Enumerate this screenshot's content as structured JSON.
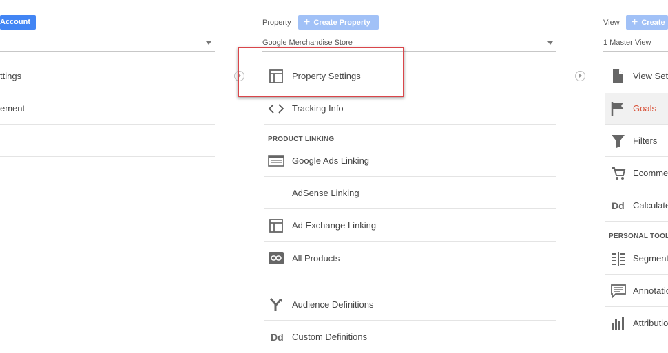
{
  "account": {
    "create_label": "Account",
    "items": [
      {
        "label": "ttings"
      },
      {
        "label": "ement"
      },
      {
        "label": ""
      },
      {
        "label": ""
      }
    ]
  },
  "property": {
    "header_label": "Property",
    "create_label": "Create Property",
    "selector_value": "Google Merchandise Store",
    "items": [
      {
        "label": "Property Settings",
        "icon": "property-settings-icon"
      },
      {
        "label": "Tracking Info",
        "icon": "code-brackets-icon"
      }
    ],
    "section_label": "PRODUCT LINKING",
    "linking_items": [
      {
        "label": "Google Ads Linking",
        "icon": "ads-linking-icon"
      },
      {
        "label": "AdSense Linking",
        "icon": ""
      },
      {
        "label": "Ad Exchange Linking",
        "icon": "ad-exchange-icon"
      },
      {
        "label": "All Products",
        "icon": "link-icon"
      }
    ],
    "more_items": [
      {
        "label": "Audience Definitions",
        "icon": "audience-fork-icon"
      },
      {
        "label": "Custom Definitions",
        "icon": "dd-icon",
        "icon_text": "Dd"
      }
    ]
  },
  "view": {
    "header_label": "View",
    "create_label": "Create",
    "selector_value": "1 Master View",
    "items": [
      {
        "label": "View Set",
        "icon": "document-icon"
      },
      {
        "label": "Goals",
        "icon": "flag-icon",
        "selected": true
      },
      {
        "label": "Filters",
        "icon": "funnel-icon"
      },
      {
        "label": "Ecomme",
        "icon": "cart-icon"
      },
      {
        "label": "Calculate",
        "icon": "dd-icon",
        "icon_text": "Dd"
      }
    ],
    "section_label": "PERSONAL TOOL",
    "tools": [
      {
        "label": "Segment",
        "icon": "segments-icon"
      },
      {
        "label": "Annotatio",
        "icon": "comment-icon"
      },
      {
        "label": "Attributio",
        "icon": "bar-chart-icon"
      }
    ]
  },
  "colors": {
    "primary_button": "#4285f4",
    "disabled_button": "#a1c1f7",
    "goals_selected": "#d9533a",
    "highlight": "#d9464a"
  }
}
